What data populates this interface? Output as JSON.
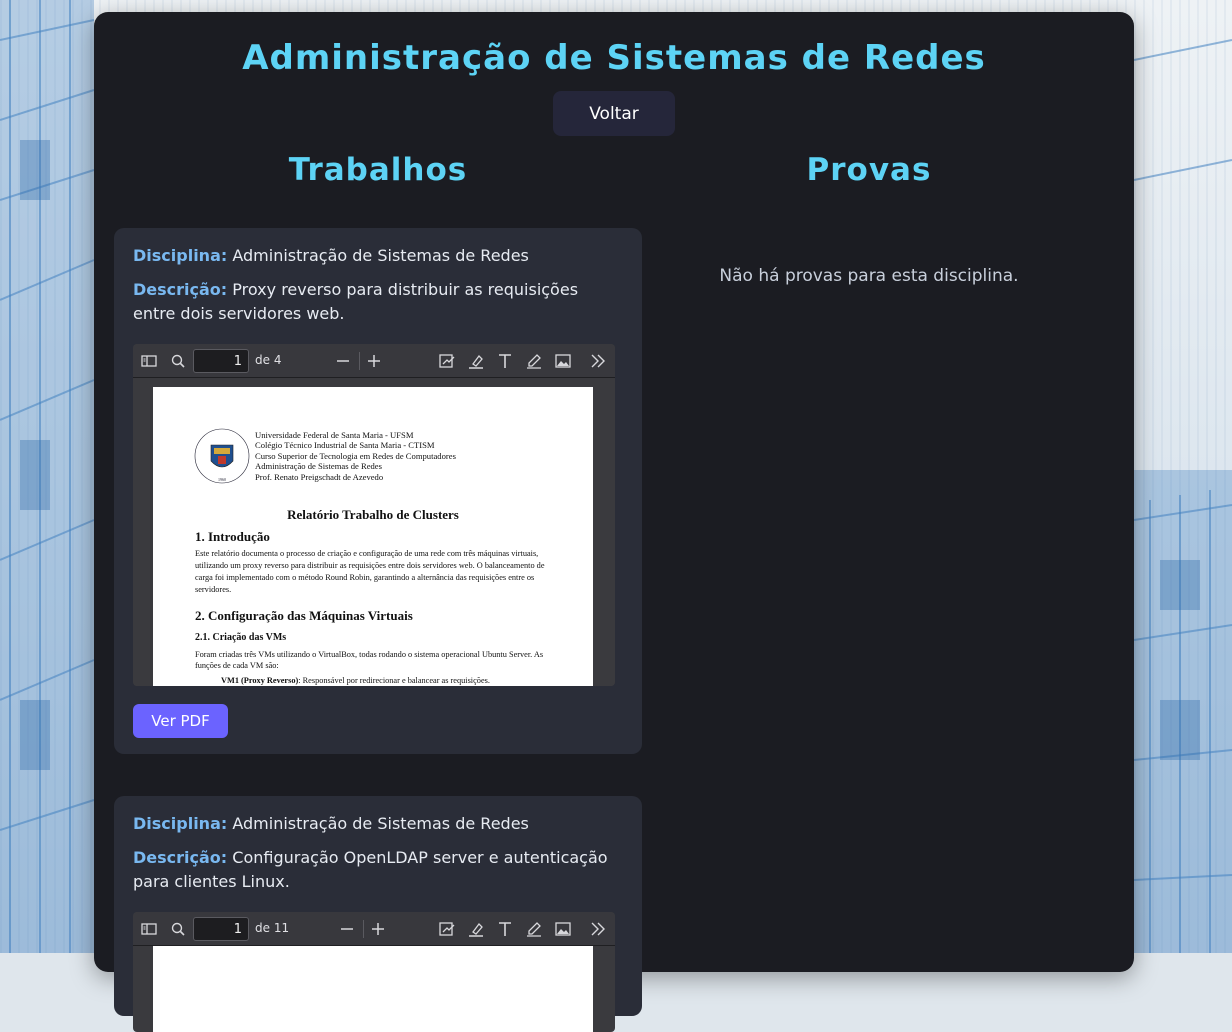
{
  "page": {
    "title": "Administração de Sistemas de Redes",
    "back_label": "Voltar"
  },
  "columns": {
    "trabalhos_title": "Trabalhos",
    "provas_title": "Provas",
    "no_exams": "Não há provas para esta disciplina."
  },
  "labels": {
    "disciplina": "Disciplina:",
    "descricao": "Descrição:"
  },
  "works": [
    {
      "disciplina": "Administração de Sistemas de Redes",
      "descricao": "Proxy reverso para distribuir as requisições entre dois servidores web.",
      "viewer": {
        "page": "1",
        "page_count": "de 4"
      },
      "button_label": "Ver PDF",
      "pdf": {
        "header_lines": [
          "Universidade Federal de Santa Maria - UFSM",
          "Colégio Técnico Industrial de Santa Maria - CTISM",
          "Curso Superior de Tecnologia em Redes de Computadores",
          "Administração de Sistemas de Redes",
          "Prof. Renato Preigschadt de Azevedo"
        ],
        "seal_text": "Universidade Federal de Santa Maria",
        "seal_year": "1960",
        "title": "Relatório Trabalho de Clusters",
        "section1": "1. Introdução",
        "para1": "Este relatório documenta o processo de criação e configuração de uma rede com três máquinas virtuais, utilizando um proxy reverso para distribuir as requisições entre dois servidores web. O balanceamento de carga foi implementado com o método Round Robin, garantindo a alternância das requisições entre os servidores.",
        "section2": "2. Configuração das Máquinas Virtuais",
        "subsection": "2.1. Criação das VMs",
        "para2": "Foram criadas três VMs utilizando o VirtualBox, todas rodando o sistema operacional Ubuntu Server. As funções de cada VM são:",
        "bullet_bold": "VM1 (Proxy Reverso)",
        "bullet_rest": ": Responsável por redirecionar e balancear as requisições."
      }
    },
    {
      "disciplina": "Administração de Sistemas de Redes",
      "descricao": "Configuração OpenLDAP server e autenticação para clientes Linux.",
      "viewer": {
        "page": "1",
        "page_count": "de 11"
      }
    }
  ],
  "icons": [
    "sidebar-toggle-icon",
    "search-icon",
    "zoom-out-icon",
    "zoom-in-icon",
    "signature-icon",
    "highlight-icon",
    "text-icon",
    "draw-icon",
    "image-icon",
    "more-tools-icon"
  ],
  "colors": {
    "accent": "#5dd3f5",
    "label": "#79b8f0",
    "button": "#6b63ff",
    "panel": "#1b1c22",
    "card": "#2a2d38"
  }
}
